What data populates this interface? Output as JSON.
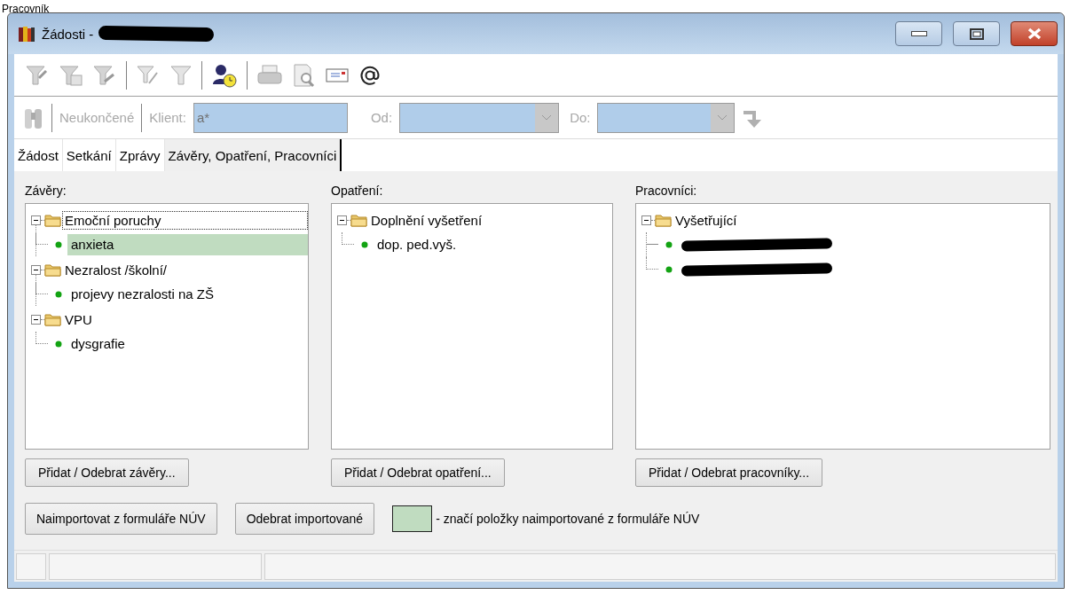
{
  "page_heading": "Pracovník",
  "window": {
    "title": "Žádosti -",
    "title_redacted": true
  },
  "filter_bar": {
    "status_label": "Neukončené",
    "client_label": "Klient:",
    "client_value": "a*",
    "from_label": "Od:",
    "to_label": "Do:"
  },
  "tabs": [
    {
      "label": "Žádost",
      "selected": false
    },
    {
      "label": "Setkání",
      "selected": false
    },
    {
      "label": "Zprávy",
      "selected": false
    },
    {
      "label": "Závěry, Opatření, Pracovníci",
      "selected": true
    }
  ],
  "panels": [
    {
      "label": "Závěry:",
      "button": "Přidat / Odebrat závěry...",
      "tree": [
        {
          "label": "Emoční poruchy",
          "expanded": true,
          "focused": true,
          "children": [
            {
              "label": "anxieta",
              "imported": true
            }
          ]
        },
        {
          "label": "Nezralost /školní/",
          "expanded": true,
          "focused": false,
          "children": [
            {
              "label": "projevy nezralosti na ZŠ",
              "imported": false
            }
          ]
        },
        {
          "label": "VPU",
          "expanded": true,
          "focused": false,
          "children": [
            {
              "label": "dysgrafie",
              "imported": false
            }
          ]
        }
      ]
    },
    {
      "label": "Opatření:",
      "button": "Přidat / Odebrat opatření...",
      "tree": [
        {
          "label": "Doplnění vyšetření",
          "expanded": true,
          "focused": false,
          "children": [
            {
              "label": "dop. ped.vyš.",
              "imported": false
            }
          ]
        }
      ]
    },
    {
      "label": "Pracovníci:",
      "button": "Přidat / Odebrat pracovníky...",
      "tree": [
        {
          "label": "Vyšetřující",
          "expanded": true,
          "focused": false,
          "children": [
            {
              "redacted": true,
              "imported": false
            },
            {
              "redacted": true,
              "imported": false
            }
          ]
        }
      ]
    }
  ],
  "actions": [
    "Naimportovat z formuláře NÚV",
    "Odebrat importované"
  ],
  "legend": {
    "color": "#c0dcc0",
    "text": "- značí položky naimportované z formuláře NÚV"
  }
}
